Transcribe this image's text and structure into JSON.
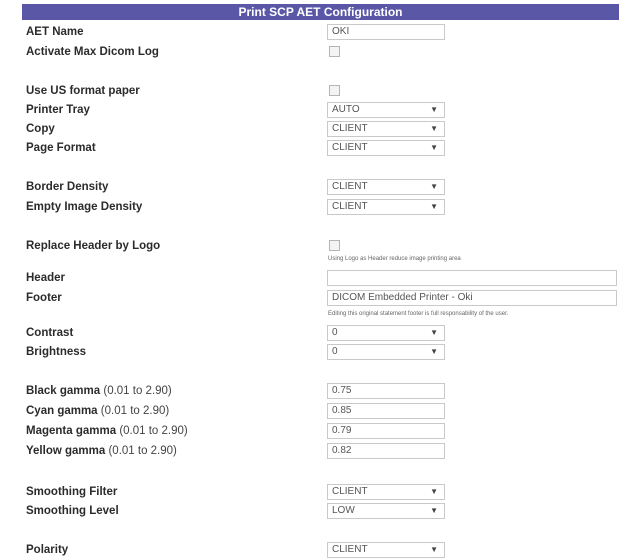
{
  "title": "Print SCP AET Configuration",
  "fields": {
    "aet_name": {
      "label": "AET Name",
      "value": "OKI"
    },
    "activate_log": {
      "label": "Activate Max Dicom Log"
    },
    "us_paper": {
      "label": "Use US format paper"
    },
    "printer_tray": {
      "label": "Printer Tray",
      "value": "AUTO"
    },
    "copy": {
      "label": "Copy",
      "value": "CLIENT"
    },
    "page_format": {
      "label": "Page Format",
      "value": "CLIENT"
    },
    "border_density": {
      "label": "Border Density",
      "value": "CLIENT"
    },
    "empty_density": {
      "label": "Empty Image Density",
      "value": "CLIENT"
    },
    "replace_header": {
      "label": "Replace Header by Logo",
      "note": "Using Logo as Header reduce image printing area"
    },
    "header": {
      "label": "Header",
      "value": ""
    },
    "footer": {
      "label": "Footer",
      "value": "DICOM Embedded Printer  -  Oki",
      "note": "Editing this original statement footer is full responsability of the user."
    },
    "contrast": {
      "label": "Contrast",
      "value": "0"
    },
    "brightness": {
      "label": "Brightness",
      "value": "0"
    },
    "black_gamma": {
      "label": "Black gamma",
      "range": "(0.01 to 2.90)",
      "value": "0.75"
    },
    "cyan_gamma": {
      "label": "Cyan gamma",
      "range": "(0.01 to 2.90)",
      "value": "0.85"
    },
    "magenta_gamma": {
      "label": "Magenta gamma",
      "range": "(0.01 to 2.90)",
      "value": "0.79"
    },
    "yellow_gamma": {
      "label": "Yellow gamma",
      "range": "(0.01 to 2.90)",
      "value": "0.82"
    },
    "smoothing_filter": {
      "label": "Smoothing Filter",
      "value": "CLIENT"
    },
    "smoothing_level": {
      "label": "Smoothing Level",
      "value": "LOW"
    },
    "polarity": {
      "label": "Polarity",
      "value": "CLIENT"
    }
  },
  "icons": {
    "dropdown": "chevron-down-icon"
  },
  "colors": {
    "title_bar": "#5a57a6",
    "title_text": "#ffffff"
  }
}
